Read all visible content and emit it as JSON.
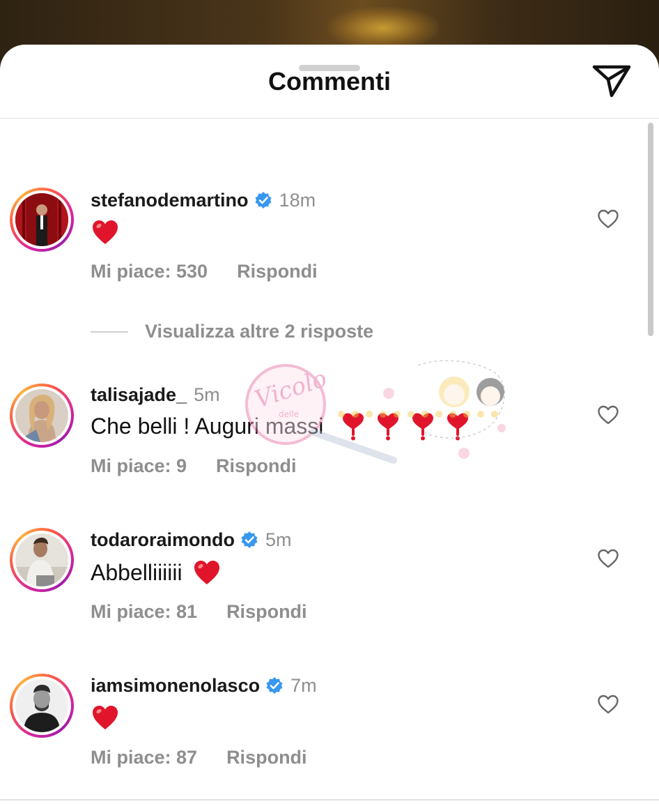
{
  "sheet": {
    "title": "Commenti",
    "share_icon": "paper-plane-icon"
  },
  "view_more_replies": "Visualizza altre 2 risposte",
  "comments": [
    {
      "username": "stefanodemartino",
      "verified": true,
      "time": "18m",
      "text": "",
      "emoji": [
        "red-heart"
      ],
      "likes": "Mi piace: 530",
      "reply": "Rispondi"
    },
    {
      "username": "talisajade_",
      "verified": false,
      "time": "5m",
      "text": "Che belli ! Auguri massi",
      "emoji": [
        "red-heart-exclamation",
        "red-heart-exclamation",
        "red-heart-exclamation",
        "red-heart-exclamation"
      ],
      "likes": "Mi piace: 9",
      "reply": "Rispondi"
    },
    {
      "username": "todaroraimondo",
      "verified": true,
      "time": "5m",
      "text": "Abbelliiiiii",
      "emoji": [
        "red-heart"
      ],
      "likes": "Mi piace: 81",
      "reply": "Rispondi"
    },
    {
      "username": "iamsimonenolasco",
      "verified": true,
      "time": "7m",
      "text": "",
      "emoji": [
        "red-heart"
      ],
      "likes": "Mi piace: 87",
      "reply": "Rispondi"
    }
  ],
  "watermark": {
    "text_main": "Vicolo",
    "text_small": "delle"
  },
  "colors": {
    "verified_blue": "#3897f0",
    "heart_red": "#e0152b",
    "muted_gray": "#8e8e8e"
  }
}
